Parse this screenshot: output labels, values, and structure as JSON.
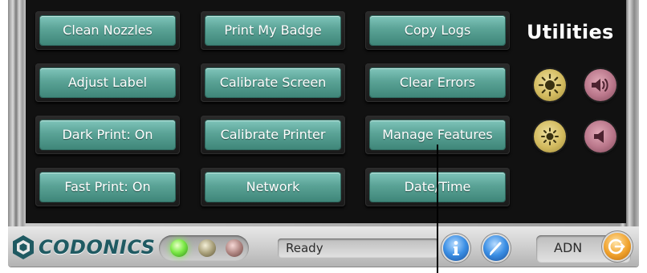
{
  "section_title": "Utilities",
  "buttons": {
    "clean_nozzles": "Clean Nozzles",
    "print_my_badge": "Print My Badge",
    "copy_logs": "Copy Logs",
    "adjust_label": "Adjust Label",
    "calibrate_screen": "Calibrate Screen",
    "clear_errors": "Clear Errors",
    "dark_print": "Dark Print: On",
    "calibrate_printer": "Calibrate Printer",
    "manage_features": "Manage Features",
    "fast_print": "Fast Print: On",
    "network": "Network",
    "date_time": "Date/Time"
  },
  "status_bar": {
    "logo_text": "CODONICS",
    "status_text": "Ready",
    "user": "ADN"
  },
  "colors": {
    "button_teal": "#5aa396",
    "screen_bg": "#111111",
    "led_green": "#7dea48",
    "brand_dark_teal": "#1f5a62"
  },
  "icons": {
    "brightness_up": "sun-large-icon",
    "brightness_down": "sun-small-icon",
    "volume_up": "speaker-loud-icon",
    "volume_down": "speaker-quiet-icon",
    "info": "info-icon",
    "help": "help-icon",
    "logout": "logout-icon"
  }
}
